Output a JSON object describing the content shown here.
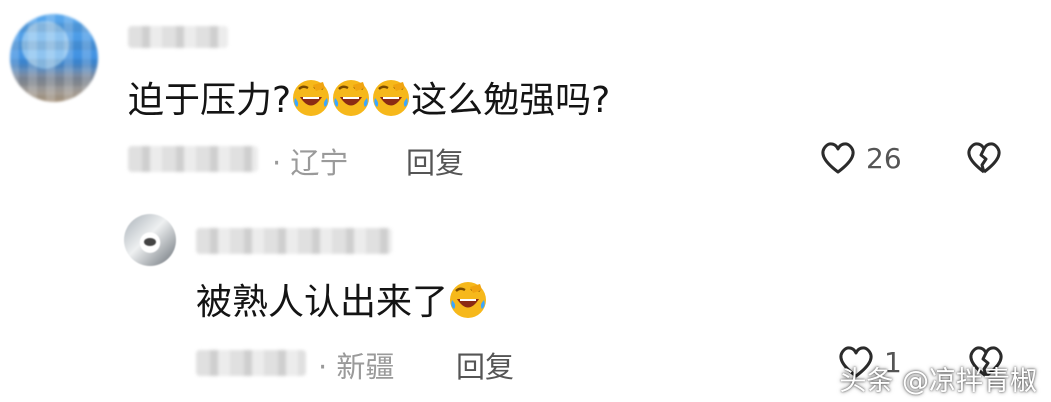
{
  "comments": [
    {
      "text_before": "迫于压力?",
      "text_after": "这么勉强吗?",
      "emoji_count": 3,
      "location": "· 辽宁",
      "reply_label": "回复",
      "like_count": "26"
    },
    {
      "text_before": "被熟人认出来了",
      "text_after": "",
      "emoji_count": 1,
      "location": "· 新疆",
      "reply_label": "回复",
      "like_count": "1"
    }
  ],
  "watermark": "头条 @凉拌青椒",
  "colors": {
    "emoji_face": "#f6b81b",
    "text": "#141414",
    "meta": "#9a9a9a"
  }
}
